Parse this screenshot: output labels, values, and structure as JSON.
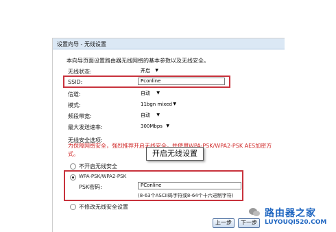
{
  "window": {
    "title": "设置向导 - 无线设置"
  },
  "intro": "本向导页面设置路由器无线网络的基本参数以及无线安全。",
  "fields": {
    "status": {
      "label": "无线状态:",
      "value": "开启"
    },
    "ssid": {
      "label": "SSID:",
      "value": "Pconline"
    },
    "channel": {
      "label": "信道:",
      "value": "自动"
    },
    "mode": {
      "label": "模式:",
      "value": "11bgn mixed"
    },
    "bandwidth": {
      "label": "频段带宽:",
      "value": "自动"
    },
    "max_rate": {
      "label": "最大发送速率:",
      "value": "300Mbps"
    }
  },
  "security": {
    "title": "无线安全选项:",
    "warning": "为保障网络安全，强烈推荐开启无线安全，并使用WPA-PSK/WPA2-PSK AES加密方式。",
    "opt_disable": "不开启无线安全",
    "opt_wpa": "WPA-PSK/WPA2-PSK",
    "psk_label": "PSK密码:",
    "psk_value": "PConline",
    "psk_hint": "(8-63个ASCII码字符或8-64个十六进制字符)",
    "opt_keep": "不修改无线安全设置"
  },
  "tooltip": "开启无线设置",
  "buttons": {
    "prev": "上一步",
    "next": "下一步"
  },
  "watermark": {
    "brand": "路由器之家",
    "url": "LUYOUQI520.COM"
  },
  "colors": {
    "highlight": "#c8323c",
    "header": "#dbe8f5",
    "watermark": "#1f66c1"
  }
}
